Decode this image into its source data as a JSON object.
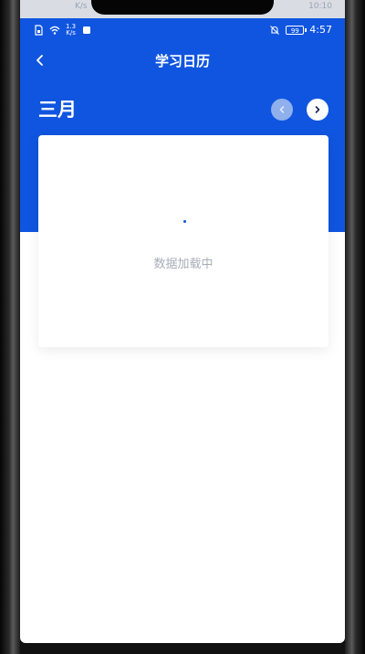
{
  "top_strip": {
    "left_text": "K/s",
    "right_text": "10:10"
  },
  "status_bar": {
    "network_speed_value": "1.3",
    "network_speed_unit": "K/s",
    "battery_level": "99",
    "time": "4:57"
  },
  "header": {
    "title": "学习日历"
  },
  "calendar": {
    "month": "三月"
  },
  "card": {
    "loading_text": "数据加载中"
  },
  "colors": {
    "brand_blue": "#1055e0",
    "loading_text": "#a7adb8"
  }
}
